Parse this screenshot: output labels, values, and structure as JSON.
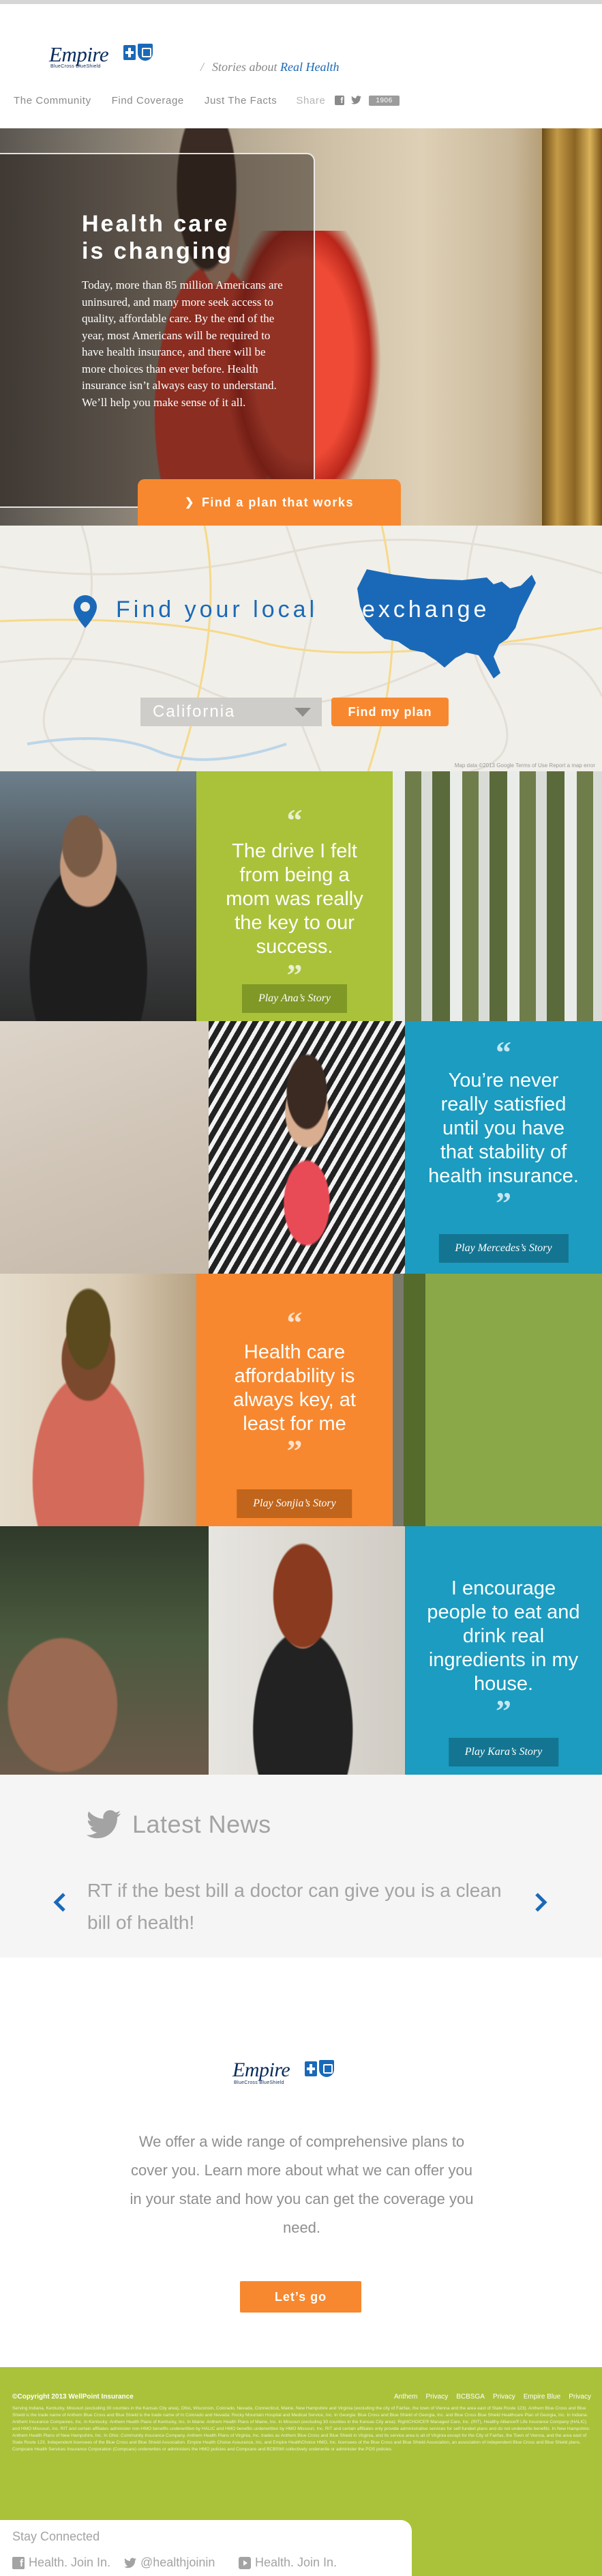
{
  "brand": {
    "name": "Empire",
    "sub": "BlueCross BlueShield",
    "tagline_prefix": "Stories about",
    "tagline_highlight": "Real Health"
  },
  "nav": {
    "items": [
      "The Community",
      "Find Coverage",
      "Just The Facts"
    ],
    "share_label": "Share",
    "share_count": "1906"
  },
  "hero": {
    "title_line1": "Health care",
    "title_line2": "is changing",
    "body": "Today, more than 85 million Americans are uninsured, and many more seek access to quality, affordable care. By the end of the year, most Americans will be required to have health insurance, and there will be more choices than ever before. Health insurance isn’t always easy to understand. We’ll help you make sense of it all.",
    "cta": "Find a plan that works"
  },
  "exchange": {
    "label": "Find your local",
    "highlight": "exchange",
    "state": "California",
    "button": "Find my plan",
    "credit": "Map data ©2013 Google   Terms of Use   Report a map error"
  },
  "stories": [
    {
      "quote": "The drive I felt from being a mom was really the key to our success.",
      "play": "Play Ana’s Story",
      "color": "#a9c23a"
    },
    {
      "quote": "You’re never really satisfied until you have that stability of health insurance.",
      "play": "Play Mercedes’s Story",
      "color": "#1b9cc0"
    },
    {
      "quote": "Health care affordability is always key, at least for me",
      "play": "Play Sonjia’s Story",
      "color": "#f7882f"
    },
    {
      "quote": "I encourage people to eat and drink real ingredients in my house.",
      "play": "Play Kara’s Story",
      "color": "#1b9cc0"
    }
  ],
  "news": {
    "title": "Latest News",
    "text": "RT if the best bill a doctor can give you is a clean bill of health!"
  },
  "about": {
    "text": "We offer a wide range of comprehensive plans to cover you. Learn more about what we can offer you in your state and how you can get the coverage you need.",
    "button": "Let’s go"
  },
  "footer": {
    "copyright": "©Copyright 2013 WellPoint Insurance",
    "links": [
      "Anthem",
      "Privacy",
      "BCBSGA",
      "Privacy",
      "Empire Blue",
      "Privacy"
    ],
    "legal": "Serving Indiana, Kentucky, Missouri (excluding 30 counties in the Kansas City area), Ohio, Wisconsin, Colorado, Nevada, Connecticut, Maine, New Hampshire and Virginia (excluding the city of Fairfax, the town of Vienna and the area east of State Route 123). Anthem Blue Cross and Blue Shield is the trade name of Anthem Blue Cross and Blue Shield is the trade name of In Colorado and Nevada: Rocky Mountain Hospital and Medical Service, Inc. In Georgia: Blue Cross and Blue Shield of Georgia, Inc. and Blue Cross Blue Shield Healthcare Plan of Georgia, Inc. In Indiana: Anthem Insurance Companies, Inc. In Kentucky: Anthem Health Plans of Kentucky, Inc. In Maine: Anthem Health Plans of Maine, Inc. In Missouri (excluding 30 counties in the Kansas City area): RightCHOICE® Managed Care, Inc. (RIT), Healthy Alliance® Life Insurance Company (HALIC) and HMO Missouri, Inc. RIT and certain affiliates administer non-HMO benefits underwritten by HALIC and HMO benefits underwritten by HMO Missouri, Inc. RIT and certain affiliates only provide administrative services for self-funded plans and do not underwrite benefits. In New Hampshire: Anthem Health Plans of New Hampshire, Inc. In Ohio: Community Insurance Company. Anthem Health Plans of Virginia, Inc. trades as Anthem Blue Cross and Blue Shield in Virginia, and its service area is all of Virginia except for the City of Fairfax, the Town of Vienna, and the area east of State Route 123. Independent licensees of the Blue Cross and Blue Shield Association. Empire Health Choice Assurance, Inc. and Empire HealthChoice HMO, Inc. licensees of the Blue Cross and Blue Shield Association, an association of independent Blue Cross and Blue Shield plans. Compcare Health Services Insurance Corporation (Compcare) underwrites or administers the HMO policies and Compcare and BCBSWI collectively underwrite or administer the POS policies.",
    "connect_title": "Stay Connected",
    "social": [
      "Health. Join In.",
      "@healthjoinin",
      "Health. Join In."
    ]
  }
}
